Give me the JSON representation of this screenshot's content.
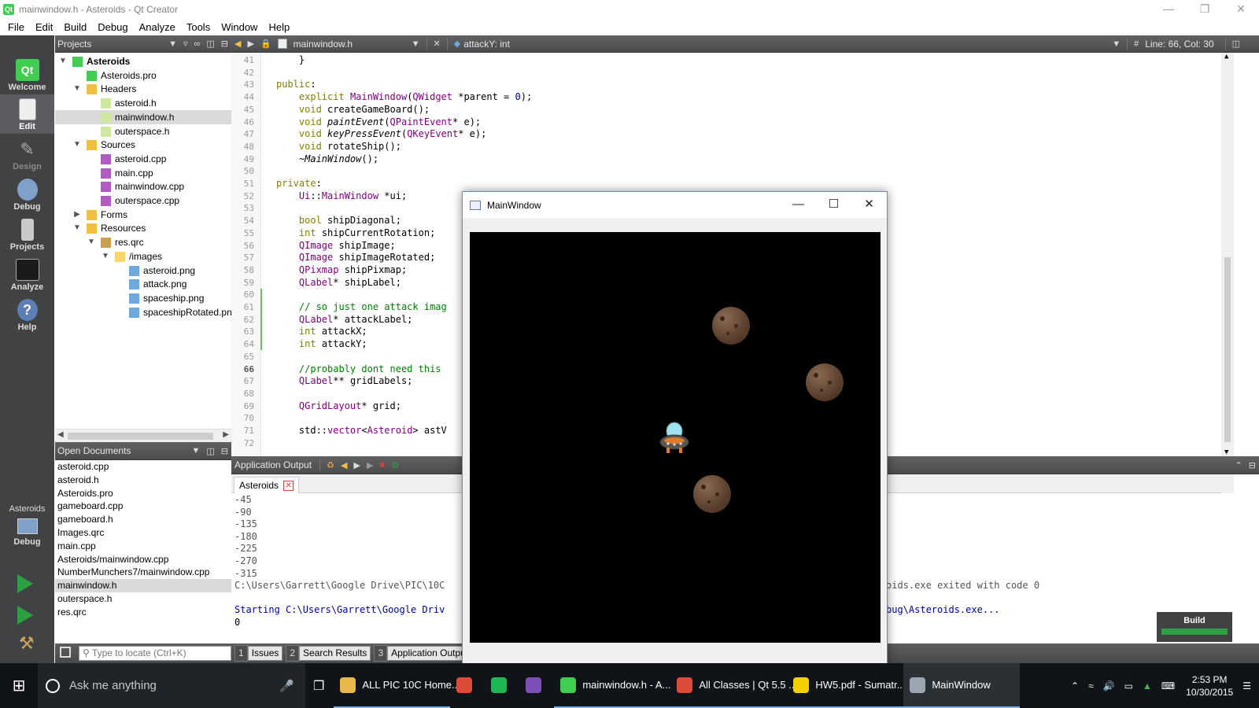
{
  "window": {
    "title": "mainwindow.h - Asteroids - Qt Creator"
  },
  "menu": [
    "File",
    "Edit",
    "Build",
    "Debug",
    "Analyze",
    "Tools",
    "Window",
    "Help"
  ],
  "modes": [
    "Welcome",
    "Edit",
    "Design",
    "Debug",
    "Projects",
    "Analyze",
    "Help"
  ],
  "kit": {
    "project": "Asteroids",
    "mode": "Debug"
  },
  "projects_panel": {
    "title": "Projects"
  },
  "tree": [
    {
      "label": "Asteroids",
      "depth": 0,
      "arrow": "▼",
      "icon": "project",
      "bold": true
    },
    {
      "label": "Asteroids.pro",
      "depth": 1,
      "arrow": "",
      "icon": "pro"
    },
    {
      "label": "Headers",
      "depth": 1,
      "arrow": "▼",
      "icon": "folder-h"
    },
    {
      "label": "asteroid.h",
      "depth": 2,
      "arrow": "",
      "icon": "header"
    },
    {
      "label": "mainwindow.h",
      "depth": 2,
      "arrow": "",
      "icon": "header",
      "selected": true
    },
    {
      "label": "outerspace.h",
      "depth": 2,
      "arrow": "",
      "icon": "header"
    },
    {
      "label": "Sources",
      "depth": 1,
      "arrow": "▼",
      "icon": "folder-c"
    },
    {
      "label": "asteroid.cpp",
      "depth": 2,
      "arrow": "",
      "icon": "cpp"
    },
    {
      "label": "main.cpp",
      "depth": 2,
      "arrow": "",
      "icon": "cpp"
    },
    {
      "label": "mainwindow.cpp",
      "depth": 2,
      "arrow": "",
      "icon": "cpp"
    },
    {
      "label": "outerspace.cpp",
      "depth": 2,
      "arrow": "",
      "icon": "cpp"
    },
    {
      "label": "Forms",
      "depth": 1,
      "arrow": "▶",
      "icon": "forms"
    },
    {
      "label": "Resources",
      "depth": 1,
      "arrow": "▼",
      "icon": "resources"
    },
    {
      "label": "res.qrc",
      "depth": 2,
      "arrow": "▼",
      "icon": "qrc"
    },
    {
      "label": "/images",
      "depth": 3,
      "arrow": "▼",
      "icon": "folder"
    },
    {
      "label": "asteroid.png",
      "depth": 4,
      "arrow": "",
      "icon": "image"
    },
    {
      "label": "attack.png",
      "depth": 4,
      "arrow": "",
      "icon": "image"
    },
    {
      "label": "spaceship.png",
      "depth": 4,
      "arrow": "",
      "icon": "image"
    },
    {
      "label": "spaceshipRotated.png",
      "depth": 4,
      "arrow": "",
      "icon": "image"
    }
  ],
  "open_docs": {
    "title": "Open Documents",
    "items": [
      "asteroid.cpp",
      "asteroid.h",
      "Asteroids.pro",
      "gameboard.cpp",
      "gameboard.h",
      "Images.qrc",
      "main.cpp",
      "Asteroids/mainwindow.cpp",
      "NumberMunchers7/mainwindow.cpp",
      "mainwindow.h",
      "outerspace.h",
      "res.qrc"
    ],
    "selected": "mainwindow.h"
  },
  "editor": {
    "file": "mainwindow.h",
    "symbol": "attackY: int",
    "position": "Line: 66, Col: 30",
    "current_line": 66,
    "lines": [
      {
        "n": 41,
        "code": [
          [
            "",
            "    }"
          ]
        ]
      },
      {
        "n": 42,
        "code": []
      },
      {
        "n": 43,
        "code": [
          [
            "kw",
            "public"
          ],
          [
            "",
            ":"
          ]
        ]
      },
      {
        "n": 44,
        "code": [
          [
            "",
            "    "
          ],
          [
            "kw",
            "explicit"
          ],
          [
            "",
            " "
          ],
          [
            "ty",
            "MainWindow"
          ],
          [
            "",
            "("
          ],
          [
            "ty",
            "QWidget"
          ],
          [
            "",
            " *parent = "
          ],
          [
            "nm",
            "0"
          ],
          [
            "",
            ");"
          ]
        ]
      },
      {
        "n": 45,
        "code": [
          [
            "",
            "    "
          ],
          [
            "kw",
            "void"
          ],
          [
            "",
            " createGameBoard();"
          ]
        ]
      },
      {
        "n": 46,
        "code": [
          [
            "",
            "    "
          ],
          [
            "kw",
            "void"
          ],
          [
            "it",
            " paintEvent"
          ],
          [
            "",
            "("
          ],
          [
            "ty",
            "QPaintEvent"
          ],
          [
            "",
            "* e);"
          ]
        ]
      },
      {
        "n": 47,
        "code": [
          [
            "",
            "    "
          ],
          [
            "kw",
            "void"
          ],
          [
            "it",
            " keyPressEvent"
          ],
          [
            "",
            "("
          ],
          [
            "ty",
            "QKeyEvent"
          ],
          [
            "",
            "* e);"
          ]
        ]
      },
      {
        "n": 48,
        "code": [
          [
            "",
            "    "
          ],
          [
            "kw",
            "void"
          ],
          [
            "",
            " rotateShip();"
          ]
        ]
      },
      {
        "n": 49,
        "code": [
          [
            "",
            "    ~"
          ],
          [
            "it",
            "MainWindow"
          ],
          [
            "",
            "();"
          ]
        ]
      },
      {
        "n": 50,
        "code": []
      },
      {
        "n": 51,
        "code": [
          [
            "kw",
            "private"
          ],
          [
            "",
            ":"
          ]
        ]
      },
      {
        "n": 52,
        "code": [
          [
            "",
            "    "
          ],
          [
            "ty",
            "Ui"
          ],
          [
            "",
            "::"
          ],
          [
            "ty",
            "MainWindow"
          ],
          [
            "",
            " *ui;"
          ]
        ]
      },
      {
        "n": 53,
        "code": []
      },
      {
        "n": 54,
        "code": [
          [
            "",
            "    "
          ],
          [
            "kw",
            "bool"
          ],
          [
            "",
            " shipDiagonal;"
          ]
        ]
      },
      {
        "n": 55,
        "code": [
          [
            "",
            "    "
          ],
          [
            "kw",
            "int"
          ],
          [
            "",
            " shipCurrentRotation;"
          ]
        ]
      },
      {
        "n": 56,
        "code": [
          [
            "",
            "    "
          ],
          [
            "ty",
            "QImage"
          ],
          [
            "",
            " shipImage;"
          ]
        ]
      },
      {
        "n": 57,
        "code": [
          [
            "",
            "    "
          ],
          [
            "ty",
            "QImage"
          ],
          [
            "",
            " shipImageRotated;"
          ]
        ]
      },
      {
        "n": 58,
        "code": [
          [
            "",
            "    "
          ],
          [
            "ty",
            "QPixmap"
          ],
          [
            "",
            " shipPixmap;"
          ]
        ]
      },
      {
        "n": 59,
        "code": [
          [
            "",
            "    "
          ],
          [
            "ty",
            "QLabel"
          ],
          [
            "",
            "* shipLabel;"
          ]
        ]
      },
      {
        "n": 60,
        "code": []
      },
      {
        "n": 61,
        "code": [
          [
            "",
            "    "
          ],
          [
            "cm",
            "// so just one attack imag"
          ]
        ]
      },
      {
        "n": 62,
        "code": [
          [
            "",
            "    "
          ],
          [
            "ty",
            "QLabel"
          ],
          [
            "",
            "* attackLabel;"
          ]
        ]
      },
      {
        "n": 63,
        "code": [
          [
            "",
            "    "
          ],
          [
            "kw",
            "int"
          ],
          [
            "",
            " attackX;"
          ]
        ]
      },
      {
        "n": 64,
        "code": [
          [
            "",
            "    "
          ],
          [
            "kw",
            "int"
          ],
          [
            "",
            " attackY;"
          ]
        ]
      },
      {
        "n": 65,
        "code": []
      },
      {
        "n": 66,
        "code": [
          [
            "",
            "    "
          ],
          [
            "cm",
            "//probably dont need this"
          ]
        ]
      },
      {
        "n": 67,
        "code": [
          [
            "",
            "    "
          ],
          [
            "ty",
            "QLabel"
          ],
          [
            "",
            "** gridLabels;"
          ]
        ]
      },
      {
        "n": 68,
        "code": []
      },
      {
        "n": 69,
        "code": [
          [
            "",
            "    "
          ],
          [
            "ty",
            "QGridLayout"
          ],
          [
            "",
            "* grid;"
          ]
        ]
      },
      {
        "n": 70,
        "code": []
      },
      {
        "n": 71,
        "code": [
          [
            "",
            "    std::"
          ],
          [
            "ty",
            "vector"
          ],
          [
            "",
            "<"
          ],
          [
            "ty",
            "Asteroid"
          ],
          [
            "",
            "> astV"
          ]
        ]
      },
      {
        "n": 72,
        "code": []
      }
    ]
  },
  "output": {
    "title": "Application Output",
    "tab": "Asteroids",
    "lines": [
      "-45",
      "-90",
      "-135",
      "-180",
      "-225",
      "-270",
      "-315"
    ],
    "exit_left": "C:\\Users\\Garrett\\Google Drive\\PIC\\10C",
    "exit_right": "oids.exe exited with code 0",
    "start_left": "Starting C:\\Users\\Garrett\\Google Driv",
    "start_right": "bug\\Asteroids.exe...",
    "last": "0"
  },
  "build": {
    "label": "Build",
    "progress": 1.0
  },
  "status": {
    "locate_placeholder": "Type to locate (Ctrl+K)",
    "panes": [
      {
        "num": "1",
        "label": "Issues"
      },
      {
        "num": "2",
        "label": "Search Results"
      },
      {
        "num": "3",
        "label": "Application Output"
      }
    ]
  },
  "app_window": {
    "title": "MainWindow"
  },
  "taskbar": {
    "search": "Ask me anything",
    "apps": [
      {
        "label": "ALL PIC 10C Home...",
        "color": "#e8b84a",
        "state": "open"
      },
      {
        "label": "",
        "color": "#dd4b39",
        "state": "none"
      },
      {
        "label": "",
        "color": "#1db954",
        "state": "none"
      },
      {
        "label": "",
        "color": "#7b4fb5",
        "state": "none"
      },
      {
        "label": "mainwindow.h - A...",
        "color": "#41cd52",
        "state": "open"
      },
      {
        "label": "All Classes | Qt 5.5 ...",
        "color": "#dd4b39",
        "state": "open"
      },
      {
        "label": "HW5.pdf - Sumatr...",
        "color": "#f5d000",
        "state": "open"
      },
      {
        "label": "MainWindow",
        "color": "#9aa6b2",
        "state": "active"
      }
    ],
    "time": "2:53 PM",
    "date": "10/30/2015"
  },
  "colors": {
    "modebar": "#404244",
    "accent": "#41cd52",
    "keyword": "#808000",
    "type": "#800080",
    "comment": "#008000"
  }
}
